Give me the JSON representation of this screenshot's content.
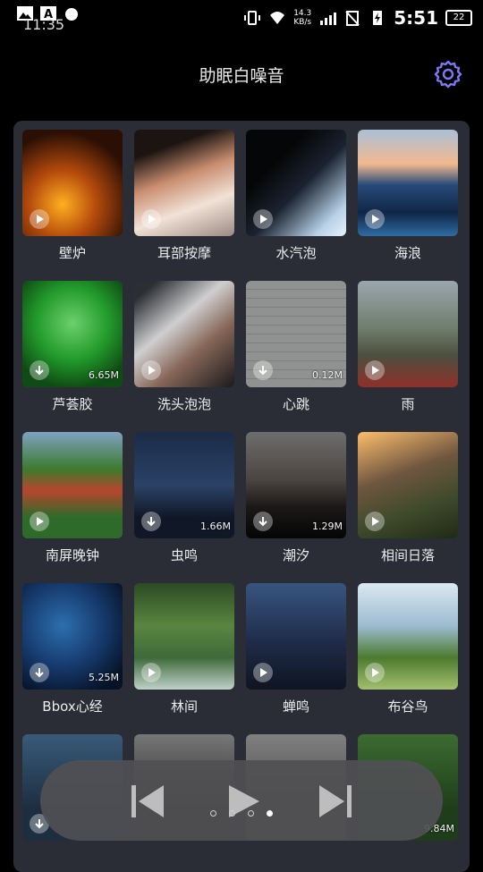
{
  "status_bar": {
    "time_left": "11:35",
    "time": "5:51",
    "net_speed": "14.3",
    "net_unit": "KB/s",
    "battery": "22",
    "icons": [
      "gallery-icon",
      "a-icon",
      "notification-badge-icon",
      "vibrate-icon",
      "wifi-icon",
      "signal-icon",
      "no-sim-icon",
      "charging-icon",
      "battery-icon"
    ]
  },
  "header": {
    "title": "助眠白噪音",
    "settings_icon": "gear-icon"
  },
  "accent_color": "#7e79f2",
  "sounds": [
    {
      "label": "壁炉",
      "state": "play",
      "size": ""
    },
    {
      "label": "耳部按摩",
      "state": "play",
      "size": ""
    },
    {
      "label": "水汽泡",
      "state": "play",
      "size": ""
    },
    {
      "label": "海浪",
      "state": "play",
      "size": ""
    },
    {
      "label": "芦荟胶",
      "state": "download",
      "size": "6.65M"
    },
    {
      "label": "洗头泡泡",
      "state": "play",
      "size": ""
    },
    {
      "label": "心跳",
      "state": "download",
      "size": "0.12M"
    },
    {
      "label": "雨",
      "state": "play",
      "size": ""
    },
    {
      "label": "南屏晚钟",
      "state": "play",
      "size": ""
    },
    {
      "label": "虫鸣",
      "state": "download",
      "size": "1.66M"
    },
    {
      "label": "潮汐",
      "state": "download",
      "size": "1.29M"
    },
    {
      "label": "相间日落",
      "state": "play",
      "size": ""
    },
    {
      "label": "Bbox心经",
      "state": "download",
      "size": "5.25M"
    },
    {
      "label": "林间",
      "state": "play",
      "size": ""
    },
    {
      "label": "蝉鸣",
      "state": "play",
      "size": ""
    },
    {
      "label": "布谷鸟",
      "state": "play",
      "size": ""
    },
    {
      "label": "",
      "state": "download",
      "size": ""
    },
    {
      "label": "",
      "state": "none",
      "size": ""
    },
    {
      "label": "",
      "state": "none",
      "size": ""
    },
    {
      "label": "",
      "state": "none",
      "size": "9.84M"
    }
  ],
  "player": {
    "prev_icon": "skip-previous-icon",
    "play_icon": "play-icon",
    "next_icon": "skip-next-icon",
    "page_count": 4,
    "active_page": 4
  }
}
